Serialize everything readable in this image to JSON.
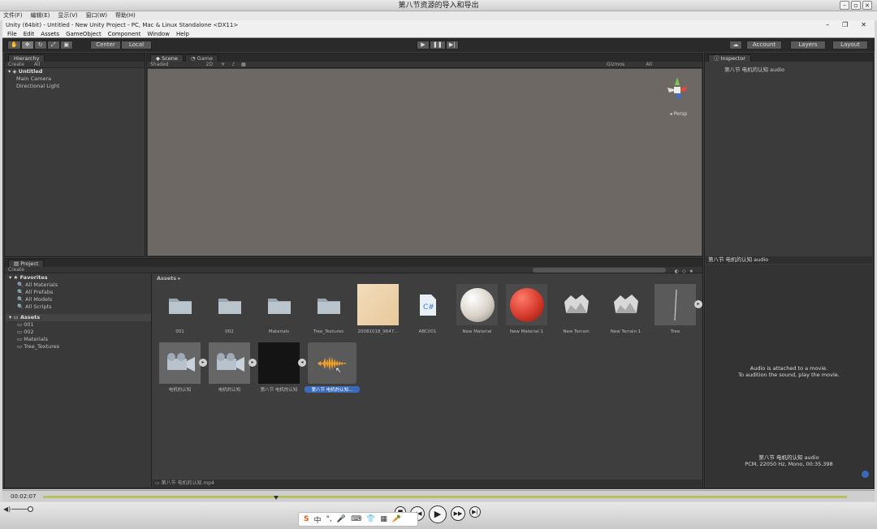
{
  "player": {
    "title": "第八节资源的导入和导出",
    "menu": [
      "文件(F)",
      "编辑(E)",
      "显示(V)",
      "窗口(W)",
      "帮助(H)"
    ],
    "time": "00:02:07",
    "progress": 0.29
  },
  "unity": {
    "title": "Unity (64bit) - Untitled - New Unity Project - PC, Mac & Linux Standalone <DX11>",
    "menu": [
      "File",
      "Edit",
      "Assets",
      "GameObject",
      "Component",
      "Window",
      "Help"
    ],
    "toolbar": {
      "pivot": "Center",
      "space": "Local",
      "account": "Account",
      "layers": "Layers",
      "layout": "Layout"
    },
    "hierarchy": {
      "tab": "Hierarchy",
      "create": "Create",
      "search": "All",
      "scene": "Untitled",
      "items": [
        "Main Camera",
        "Directional Light"
      ]
    },
    "scene": {
      "tab_scene": "Scene",
      "tab_game": "Game",
      "shading": "Shaded",
      "mode": "2D",
      "gizmos": "Gizmos",
      "search": "All",
      "persp": "Persp"
    },
    "inspector": {
      "tab": "Inspector",
      "asset_name": "第八节 电机的认知 audio",
      "preview_title": "第八节 电机的认知 audio",
      "preview_msg1": "Audio is attached to a movie.",
      "preview_msg2": "To audition the sound, play the movie.",
      "info1": "第八节 电机的认知 audio",
      "info2": "PCM, 22050 Hz, Mono, 00:35.398"
    },
    "project": {
      "tab": "Project",
      "create": "Create",
      "favorites_title": "Favorites",
      "favorites": [
        "All Materials",
        "All Prefabs",
        "All Models",
        "All Scripts"
      ],
      "assets_title": "Assets",
      "folders": [
        "001",
        "002",
        "Materials",
        "Tree_Textures"
      ],
      "breadcrumb": "Assets",
      "items": [
        {
          "label": "001",
          "kind": "folder"
        },
        {
          "label": "002",
          "kind": "folder"
        },
        {
          "label": "Materials",
          "kind": "folder"
        },
        {
          "label": "Tree_Textures",
          "kind": "folder"
        },
        {
          "label": "20081018_9647...",
          "kind": "texture"
        },
        {
          "label": "ABC001",
          "kind": "script"
        },
        {
          "label": "New Material",
          "kind": "material-white"
        },
        {
          "label": "New Material 1",
          "kind": "material-red"
        },
        {
          "label": "New Terrain",
          "kind": "terrain"
        },
        {
          "label": "New Terrain 1",
          "kind": "terrain"
        },
        {
          "label": "Tree",
          "kind": "tree"
        }
      ],
      "items2": [
        {
          "label": "电机的认知",
          "kind": "movie"
        },
        {
          "label": "电机的认知",
          "kind": "movie"
        },
        {
          "label": "第八节 电机的认知",
          "kind": "black"
        },
        {
          "label": "第八节 电机的认知...",
          "kind": "audio",
          "selected": true
        }
      ],
      "status_path": "第八节 电机的认知.mp4"
    }
  },
  "ime": {
    "items": [
      "S",
      "中",
      "°,",
      "🎤",
      "⌨",
      "👕",
      "▦",
      "🥕"
    ]
  }
}
